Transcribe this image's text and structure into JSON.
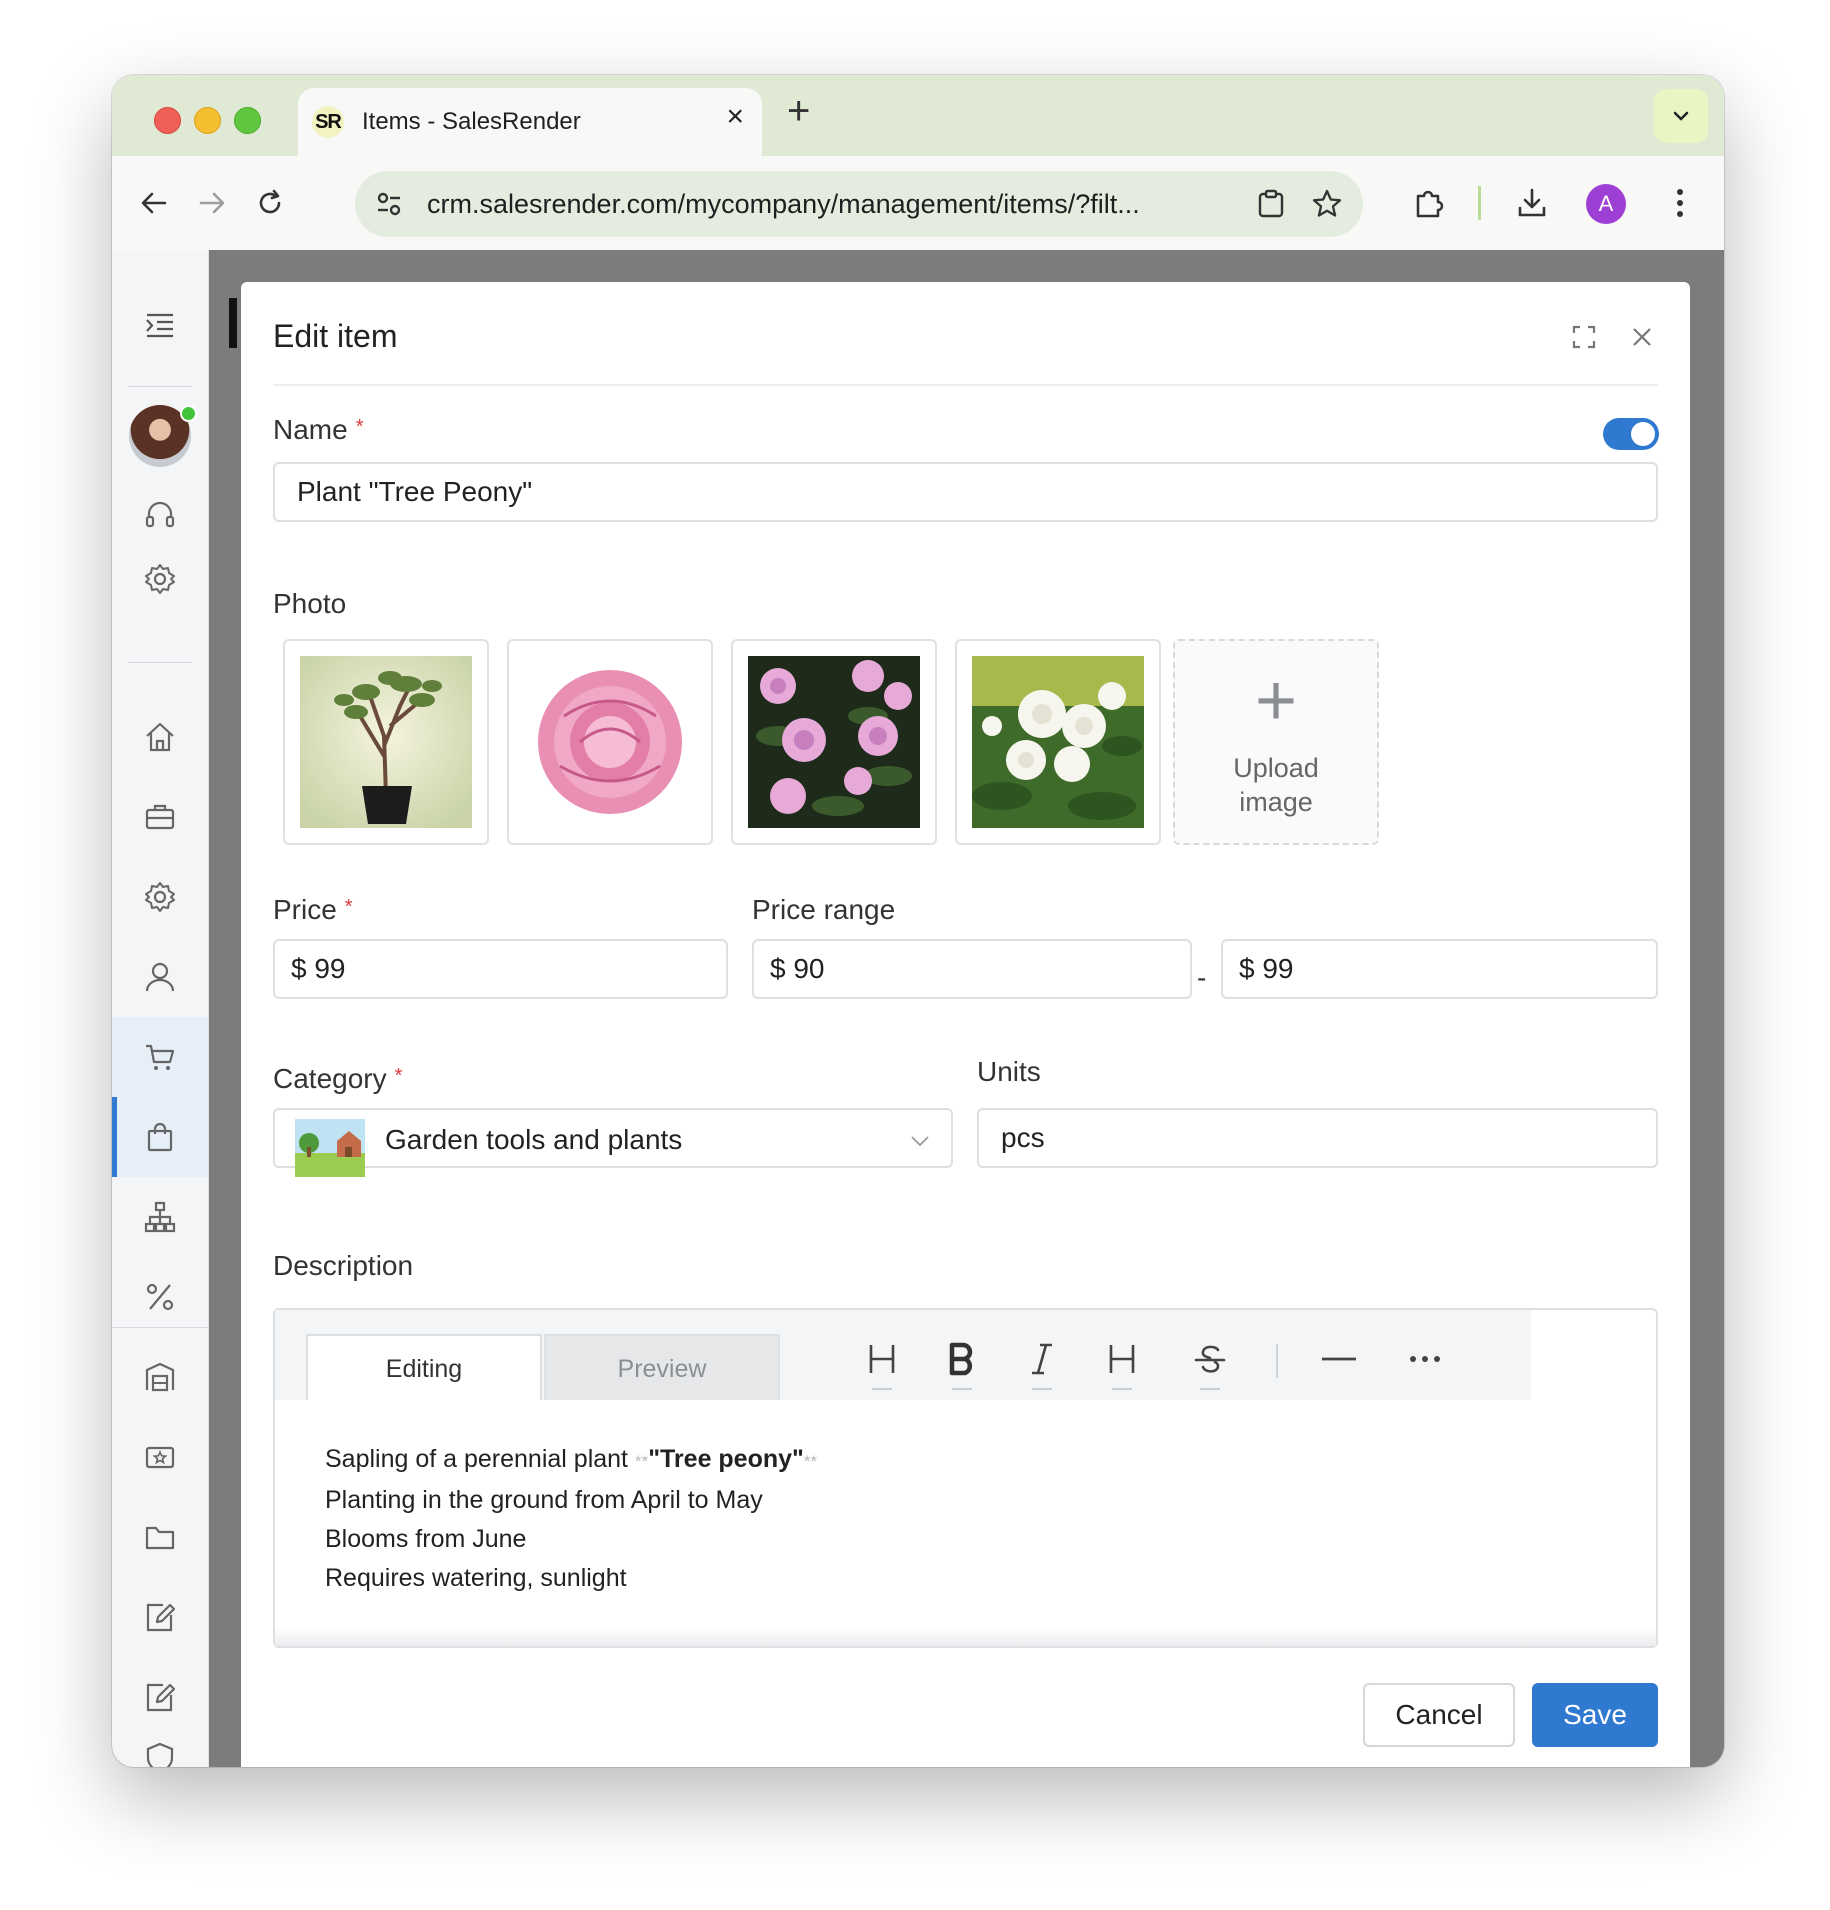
{
  "browser": {
    "tab_favicon": "SR",
    "tab_title": "Items - SalesRender",
    "url": "crm.salesrender.com/mycompany/management/items/?filt...",
    "profile_initial": "A"
  },
  "modal": {
    "title": "Edit item",
    "name_label": "Name",
    "name_value": "Plant \"Tree Peony\"",
    "active_toggle": true,
    "photo_label": "Photo",
    "upload_line1": "Upload",
    "upload_line2": "image",
    "price_label": "Price",
    "price_value": "$ 99",
    "price_range_label": "Price range",
    "price_range_from": "$ 90",
    "price_range_separator": "-",
    "price_range_to": "$ 99",
    "category_label": "Category",
    "category_value": "Garden tools and plants",
    "units_label": "Units",
    "units_value": "pcs",
    "description_label": "Description",
    "editor_tab_editing": "Editing",
    "editor_tab_preview": "Preview",
    "description": {
      "line1_prefix": "Sapling of a perennial plant ",
      "line1_bold_marker": "**",
      "line1_bold": "\"Tree peony\"",
      "line2": "Planting in the ground from April to May",
      "line3": "Blooms from June",
      "line4": "Requires watering, sunlight"
    },
    "cancel_label": "Cancel",
    "save_label": "Save"
  },
  "colors": {
    "accent": "#2f7ad0",
    "required": "#e0383e",
    "tab_strip": "#dfe9d3"
  }
}
